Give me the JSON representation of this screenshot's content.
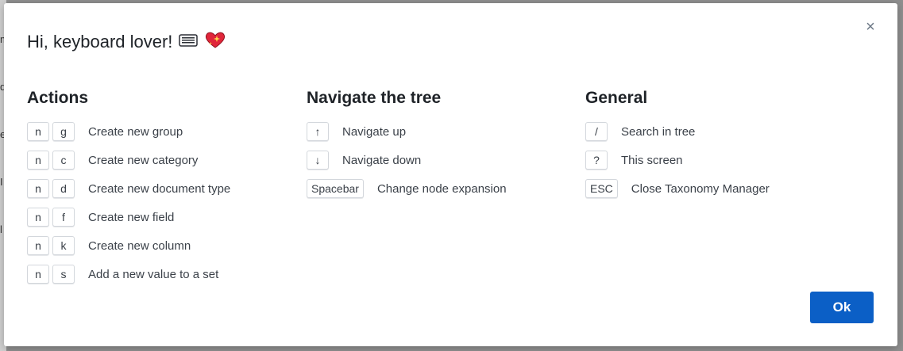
{
  "backdrop": {
    "chars": [
      "m",
      "d",
      "e",
      "I",
      "l"
    ]
  },
  "dialog": {
    "title": "Hi, keyboard lover!",
    "close_label": "×",
    "ok_label": "Ok"
  },
  "columns": [
    {
      "heading": "Actions",
      "rows": [
        {
          "keys": [
            "n",
            "g"
          ],
          "desc": "Create new group"
        },
        {
          "keys": [
            "n",
            "c"
          ],
          "desc": "Create new category"
        },
        {
          "keys": [
            "n",
            "d"
          ],
          "desc": "Create new document type"
        },
        {
          "keys": [
            "n",
            "f"
          ],
          "desc": "Create new field"
        },
        {
          "keys": [
            "n",
            "k"
          ],
          "desc": "Create new column"
        },
        {
          "keys": [
            "n",
            "s"
          ],
          "desc": "Add a new value to a set"
        }
      ]
    },
    {
      "heading": "Navigate the tree",
      "rows": [
        {
          "keys": [
            "↑"
          ],
          "desc": "Navigate up"
        },
        {
          "keys": [
            "↓"
          ],
          "desc": "Navigate down"
        },
        {
          "keys": [
            "Spacebar"
          ],
          "desc": "Change node expansion"
        }
      ]
    },
    {
      "heading": "General",
      "rows": [
        {
          "keys": [
            "/"
          ],
          "desc": "Search in tree"
        },
        {
          "keys": [
            "?"
          ],
          "desc": "This screen"
        },
        {
          "keys": [
            "ESC"
          ],
          "desc": "Close Taxonomy Manager"
        }
      ]
    }
  ],
  "icons": {
    "keyboard": "keyboard-icon",
    "heart": "sparkling-heart-icon",
    "close": "close-icon"
  }
}
